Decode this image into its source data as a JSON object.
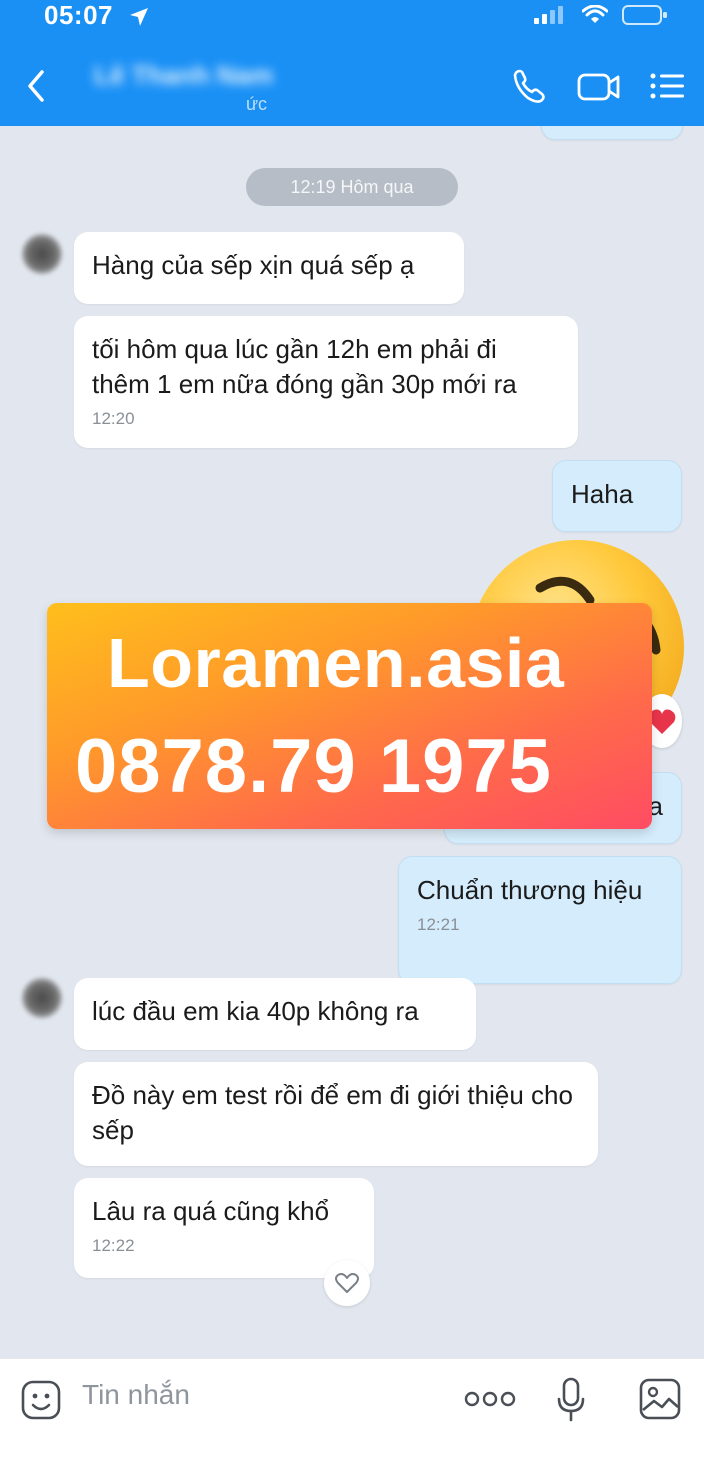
{
  "status_bar": {
    "time": "05:07"
  },
  "header": {
    "contact_name": "Lê Thanh Nam",
    "contact_status": "ức"
  },
  "chat": {
    "date_separator": "12:19 Hôm qua",
    "peek_bubble_text": "",
    "messages": [
      {
        "from": "them",
        "text": "Hàng của sếp xịn quá sếp ạ",
        "time": ""
      },
      {
        "from": "them",
        "text": "tối hôm qua lúc gần 12h em phải đi thêm 1 em nữa đóng gần 30p mới ra",
        "time": "12:20"
      },
      {
        "from": "me",
        "text": "Haha",
        "time": ""
      },
      {
        "from": "me",
        "text": "a",
        "time": ""
      },
      {
        "from": "me",
        "text": "Chuẩn thương hiệu",
        "time": "12:21"
      },
      {
        "from": "them",
        "text": "lúc đầu em kia 40p không ra",
        "time": ""
      },
      {
        "from": "them",
        "text": "Đồ này em test rồi để em đi giới thiệu cho sếp",
        "time": ""
      },
      {
        "from": "them",
        "text": "Lâu ra quá cũng khổ",
        "time": "12:22"
      }
    ]
  },
  "ad_banner": {
    "title": "Loramen.asia",
    "phone": "0878.79 1975"
  },
  "input_bar": {
    "placeholder": "Tin nhắn"
  },
  "icons": {
    "status": [
      "location-arrow-icon",
      "signal-icon",
      "wifi-icon",
      "battery-icon"
    ],
    "header": [
      "back-icon",
      "phone-icon",
      "video-call-icon",
      "menu-icon"
    ],
    "input": [
      "emoji-icon",
      "more-icon",
      "microphone-icon",
      "image-icon"
    ]
  },
  "colors": {
    "header_bg": "#1a90f5",
    "chat_bg": "#e2e7ef",
    "my_bubble": "#d4ecfb",
    "their_bubble": "#ffffff",
    "ad_gradient_start": "#ffbf1c",
    "ad_gradient_end": "#ff4c63"
  }
}
